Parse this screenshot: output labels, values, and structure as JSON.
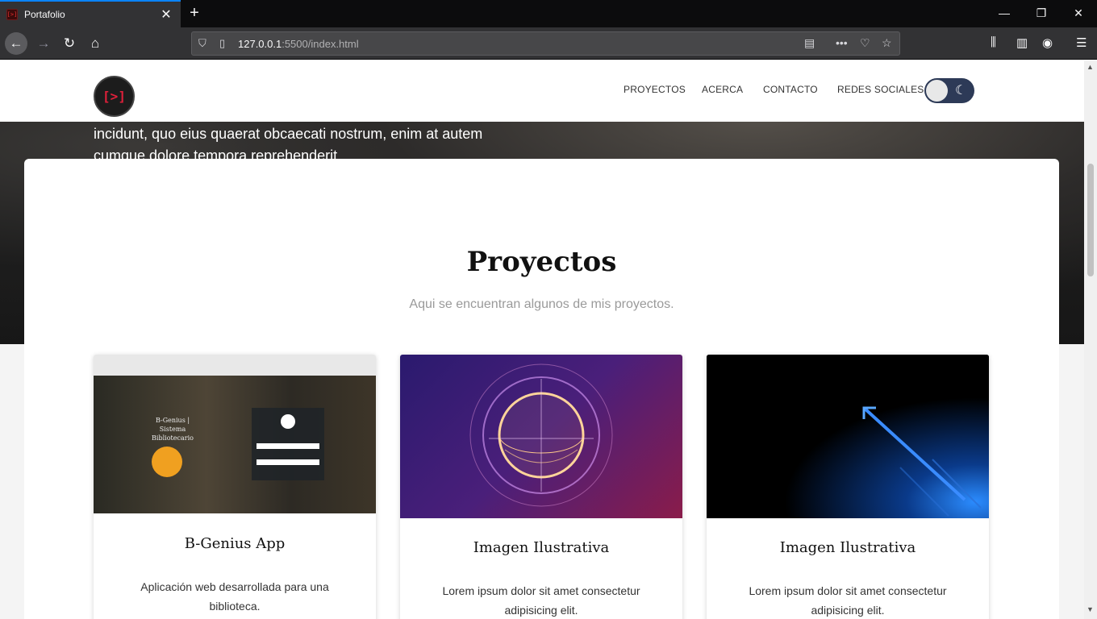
{
  "browser": {
    "tab_title": "Portafolio",
    "url_host": "127.0.0.1",
    "url_path": ":5500/index.html"
  },
  "header": {
    "logo_text": "[>]",
    "menu": [
      "PROYECTOS",
      "ACERCA",
      "CONTACTO",
      "REDES SOCIALES"
    ]
  },
  "hero": {
    "text": "incidunt, quo eius quaerat obcaecati nostrum, enim at autem cumque dolore tempora reprehenderit."
  },
  "projects": {
    "title": "Proyectos",
    "subtitle": "Aqui se encuentran algunos de mis proyectos.",
    "cards": [
      {
        "title": "B-Genius App",
        "description": "Aplicación web desarrollada para una biblioteca.",
        "image_caption": "B-Genius | Sistema Bibliotecario"
      },
      {
        "title": "Imagen Ilustrativa",
        "description": "Lorem ipsum dolor sit amet consectetur adipisicing elit."
      },
      {
        "title": "Imagen Ilustrativa",
        "description": "Lorem ipsum dolor sit amet consectetur adipisicing elit."
      }
    ]
  },
  "colors": {
    "accent": "#0a84ff",
    "logo_red": "#e0203a",
    "toggle_bg": "#2d3a57"
  }
}
